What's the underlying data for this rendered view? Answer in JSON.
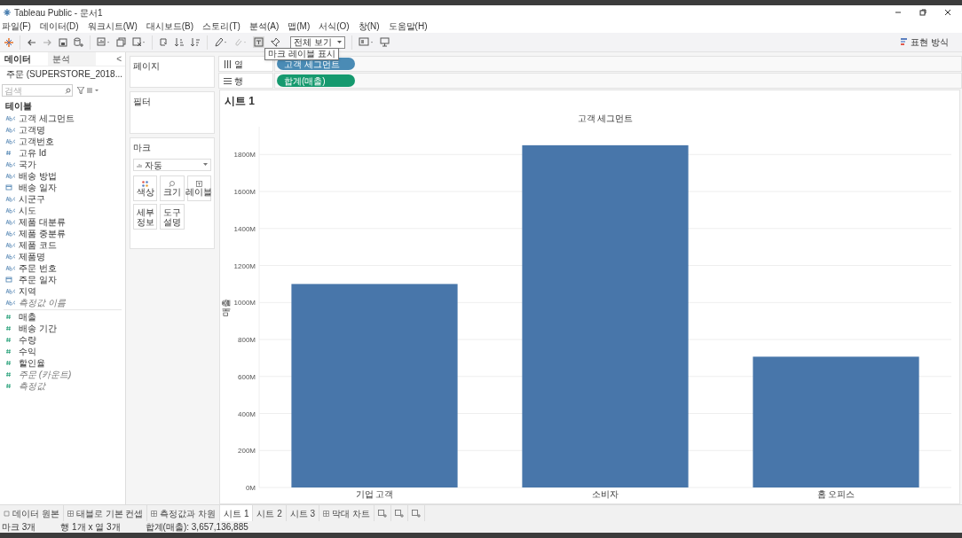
{
  "window": {
    "title": "Tableau Public - 문서1"
  },
  "menu": [
    "파일(F)",
    "데이터(D)",
    "워크시트(W)",
    "대시보드(B)",
    "스토리(T)",
    "분석(A)",
    "맵(M)",
    "서식(O)",
    "창(N)",
    "도움말(H)"
  ],
  "toolbar": {
    "fit_dropdown": "전체 보기",
    "tooltip": "마크 레이블 표시",
    "show_me": "표현 방식"
  },
  "data_pane": {
    "tabs": [
      {
        "label": "데이터",
        "selected": true
      },
      {
        "label": "분석",
        "selected": false
      }
    ],
    "collapse": "<",
    "source": "주문 (SUPERSTORE_2018...",
    "search": {
      "placeholder": "검색"
    },
    "section": "테이블",
    "fields": [
      {
        "name": "고객 세그먼트",
        "kind": "abc",
        "italic": false
      },
      {
        "name": "고객명",
        "kind": "abc",
        "italic": false
      },
      {
        "name": "고객번호",
        "kind": "abc",
        "italic": false
      },
      {
        "name": "고유 Id",
        "kind": "number",
        "italic": false
      },
      {
        "name": "국가",
        "kind": "abc",
        "italic": false
      },
      {
        "name": "배송 방법",
        "kind": "abc",
        "italic": false
      },
      {
        "name": "배송 일자",
        "kind": "date",
        "italic": false
      },
      {
        "name": "시군구",
        "kind": "abc",
        "italic": false
      },
      {
        "name": "시도",
        "kind": "abc",
        "italic": false
      },
      {
        "name": "제품 대분류",
        "kind": "abc",
        "italic": false
      },
      {
        "name": "제품 중분류",
        "kind": "abc",
        "italic": false
      },
      {
        "name": "제품 코드",
        "kind": "abc",
        "italic": false
      },
      {
        "name": "제품명",
        "kind": "abc",
        "italic": false
      },
      {
        "name": "주문 번호",
        "kind": "abc",
        "italic": false
      },
      {
        "name": "주문 일자",
        "kind": "date",
        "italic": false
      },
      {
        "name": "지역",
        "kind": "abc",
        "italic": false
      },
      {
        "name": "측정값 이름",
        "kind": "abc",
        "italic": true
      }
    ],
    "measures": [
      {
        "name": "매출",
        "kind": "measure",
        "italic": false
      },
      {
        "name": "배송 기간",
        "kind": "measure",
        "italic": false
      },
      {
        "name": "수량",
        "kind": "measure",
        "italic": false
      },
      {
        "name": "수익",
        "kind": "measure",
        "italic": false
      },
      {
        "name": "할인율",
        "kind": "measure",
        "italic": false
      },
      {
        "name": "주문 (카운트)",
        "kind": "measure",
        "italic": true
      },
      {
        "name": "측정값",
        "kind": "measure",
        "italic": true
      }
    ]
  },
  "cards": {
    "pages": "페이지",
    "filters": "필터",
    "marks": {
      "title": "마크",
      "type": "자동",
      "buttons": [
        {
          "label": "색상",
          "kind": "color"
        },
        {
          "label": "크기",
          "kind": "size"
        },
        {
          "label": "레이블",
          "kind": "label"
        },
        {
          "label": "세부\n정보",
          "kind": "detail"
        },
        {
          "label": "도구\n설명",
          "kind": "tooltip"
        }
      ]
    }
  },
  "shelves": [
    {
      "label": "열",
      "kind": "columns",
      "pill": "고객 세그먼트",
      "color": "#4a8bb5"
    },
    {
      "label": "행",
      "kind": "rows",
      "pill": "합계(매출)",
      "color": "#15996e"
    }
  ],
  "sheet": {
    "title": "시트 1",
    "chart_data": {
      "type": "bar",
      "title": "고객 세그먼트",
      "ylabel": "매출",
      "categories": [
        "기업 고객",
        "소비자",
        "홈 오피스"
      ],
      "values": [
        1100,
        1850,
        707
      ],
      "ylim": [
        0,
        1950
      ],
      "grid": true,
      "yticks": [
        {
          "value": 0,
          "label": "0M"
        },
        {
          "value": 200,
          "label": "200M"
        },
        {
          "value": 400,
          "label": "400M"
        },
        {
          "value": 600,
          "label": "600M"
        },
        {
          "value": 800,
          "label": "800M"
        },
        {
          "value": 1000,
          "label": "1000M"
        },
        {
          "value": 1200,
          "label": "1200M"
        },
        {
          "value": 1400,
          "label": "1400M"
        },
        {
          "value": 1600,
          "label": "1600M"
        },
        {
          "value": 1800,
          "label": "1800M"
        }
      ]
    }
  },
  "sheet_tabs": [
    {
      "label": "데이터 원본",
      "kind": "datasource",
      "selected": false
    },
    {
      "label": "태블로 기본 컨셉",
      "kind": "dashboard",
      "selected": false
    },
    {
      "label": "측정값과 차원",
      "kind": "dashboard",
      "selected": false
    },
    {
      "label": "시트 1",
      "kind": "sheet",
      "selected": true
    },
    {
      "label": "시트 2",
      "kind": "sheet",
      "selected": false
    },
    {
      "label": "시트 3",
      "kind": "sheet",
      "selected": false
    },
    {
      "label": "막대 차트",
      "kind": "dashboard",
      "selected": false
    }
  ],
  "status_bar": [
    "마크 3개",
    "행 1개 x 열 3개",
    "합계(매출): 3,657,136,885"
  ]
}
